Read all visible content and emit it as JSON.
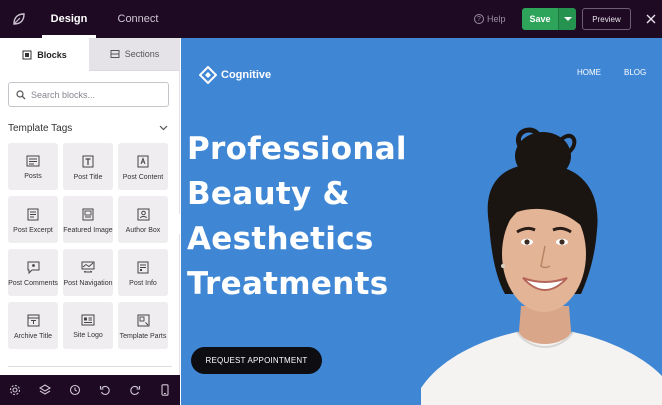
{
  "topbar": {
    "tabs": [
      {
        "label": "Design",
        "active": true
      },
      {
        "label": "Connect",
        "active": false
      }
    ],
    "help_label": "Help",
    "save_label": "Save",
    "preview_label": "Preview"
  },
  "sidebar": {
    "tabs": [
      {
        "label": "Blocks",
        "active": true
      },
      {
        "label": "Sections",
        "active": false
      }
    ],
    "search": {
      "placeholder": "Search blocks...",
      "value": ""
    },
    "section_title": "Template Tags",
    "blocks": [
      {
        "label": "Posts",
        "icon": "posts-icon"
      },
      {
        "label": "Post Title",
        "icon": "post-title-icon"
      },
      {
        "label": "Post Content",
        "icon": "post-content-icon"
      },
      {
        "label": "Post Excerpt",
        "icon": "post-excerpt-icon"
      },
      {
        "label": "Featured Image",
        "icon": "featured-image-icon"
      },
      {
        "label": "Author Box",
        "icon": "author-box-icon"
      },
      {
        "label": "Post Comments",
        "icon": "post-comments-icon"
      },
      {
        "label": "Post Navigation",
        "icon": "post-navigation-icon"
      },
      {
        "label": "Post Info",
        "icon": "post-info-icon"
      },
      {
        "label": "Archive Title",
        "icon": "archive-title-icon"
      },
      {
        "label": "Site Logo",
        "icon": "site-logo-icon"
      },
      {
        "label": "Template Parts",
        "icon": "template-parts-icon"
      }
    ],
    "bottom_icons": [
      "settings-icon",
      "layers-icon",
      "history-icon",
      "undo-icon",
      "redo-icon",
      "mobile-icon"
    ]
  },
  "canvas": {
    "brand": "Cognitive",
    "nav": [
      "HOME",
      "BLOG"
    ],
    "headline": [
      "Professional",
      "Beauty &",
      "Aesthetics",
      "Treatments"
    ],
    "cta_label": "REQUEST APPOINTMENT"
  },
  "colors": {
    "topbar_bg": "#1f0a24",
    "save_green": "#2ea35a",
    "canvas_blue": "#3f86d4",
    "cta_bg": "#0d0d12"
  }
}
